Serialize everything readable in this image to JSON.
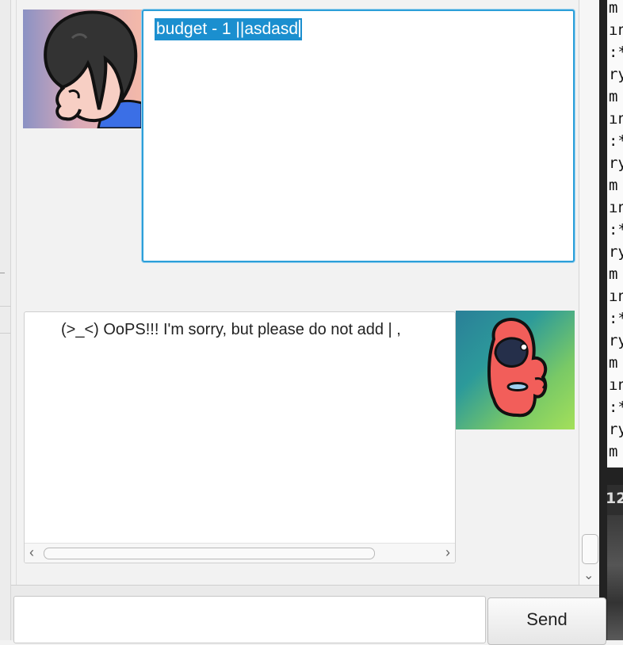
{
  "conversation": {
    "user_message": "budget - 1 ||asdasd",
    "bot_message": "(>_<) OoPS!!! I'm sorry, but please do not add | ,"
  },
  "input": {
    "value": "",
    "placeholder": ""
  },
  "send_button": {
    "label": "Send"
  },
  "terminal": {
    "lines": [
      "m",
      "ın",
      ":*",
      "ry",
      "m",
      "ın",
      ":*",
      "ry",
      "m",
      "ın",
      ":*",
      "ry",
      "m",
      "ın",
      ":*",
      "ry",
      "m",
      "ın",
      ":*",
      "ry",
      "m"
    ],
    "label": "12"
  },
  "icons": {
    "user_avatar": "user-avatar",
    "bot_avatar": "bot-avatar",
    "hscroll_left": "chevron-left-icon",
    "hscroll_right": "chevron-right-icon",
    "vscroll_down": "chevron-down-icon"
  },
  "colors": {
    "selection": "#1b8fcf",
    "focus_border": "#2c9fd9",
    "panel_bg": "#f2f2f2"
  }
}
